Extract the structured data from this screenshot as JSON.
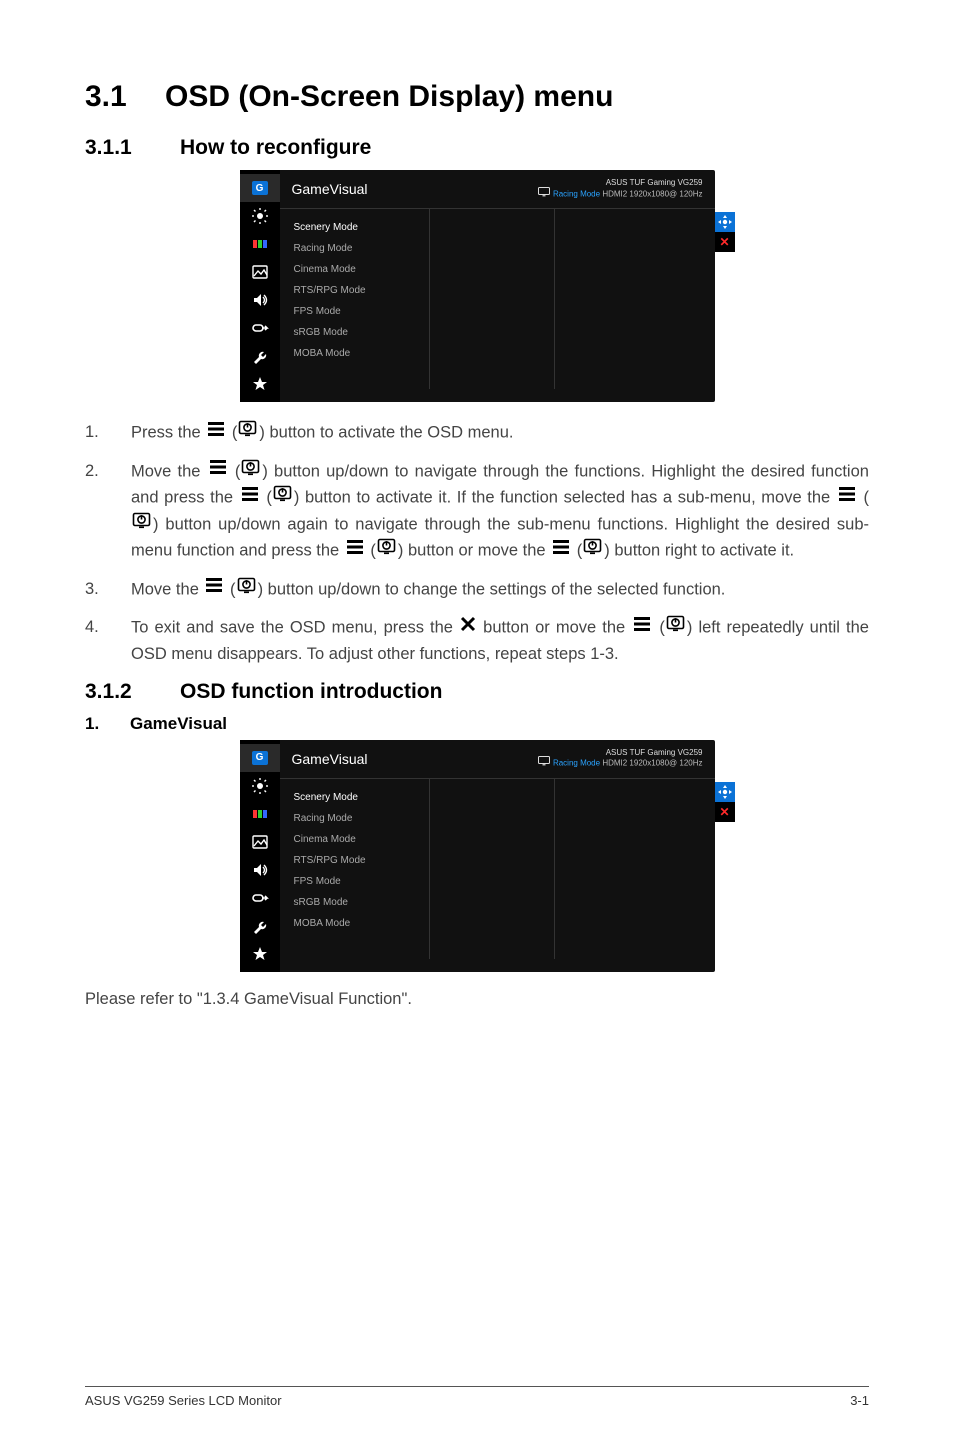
{
  "headings": {
    "section_num": "3.1",
    "section_title": "OSD (On-Screen Display) menu",
    "sub1_num": "3.1.1",
    "sub1_title": "How to reconfigure",
    "sub2_num": "3.1.2",
    "sub2_title": "OSD function introduction",
    "item1_num": "1.",
    "item1_title": "GameVisual"
  },
  "osd": {
    "title": "GameVisual",
    "status_line1": "ASUS TUF Gaming  VG259",
    "status_line2a": "Racing Mode",
    "status_line2b": "HDMI2 1920x1080@ 120Hz",
    "items": [
      "Scenery Mode",
      "Racing Mode",
      "Cinema Mode",
      "RTS/RPG Mode",
      "FPS Mode",
      "sRGB Mode",
      "MOBA Mode"
    ],
    "sidebar_icons": [
      "gamevisual-icon",
      "bluelight-icon",
      "color-icon",
      "image-icon",
      "sound-icon",
      "input-icon",
      "system-icon",
      "myfavorite-icon"
    ],
    "right_icons": [
      "joystick-icon",
      "close-icon"
    ]
  },
  "steps": {
    "s1_num": "1.",
    "s1_a": "Press the ",
    "s1_b": " button to activate the OSD menu.",
    "s2_num": "2.",
    "s2_a": "Move the ",
    "s2_b": " button up/down to navigate through the functions. Highlight the desired function and press the ",
    "s2_c": " button to activate it. If the function selected has a sub-menu, move the ",
    "s2_d": " button up/down again to navigate through the sub-menu functions. Highlight the desired sub-menu function and press the ",
    "s2_e": " button or move the ",
    "s2_f": " button right to activate it.",
    "s3_num": "3.",
    "s3_a": "Move the ",
    "s3_b": " button up/down to change the settings of the selected function.",
    "s4_num": "4.",
    "s4_a": "To exit and save the OSD menu, press the ",
    "s4_b": " button or move the ",
    "s4_c": " left repeatedly until the OSD menu disappears. To adjust other functions, repeat steps 1-3."
  },
  "refer": "Please refer to \"1.3.4     GameVisual Function\".",
  "footer": {
    "left": "ASUS VG259 Series LCD Monitor",
    "right": "3-1"
  }
}
